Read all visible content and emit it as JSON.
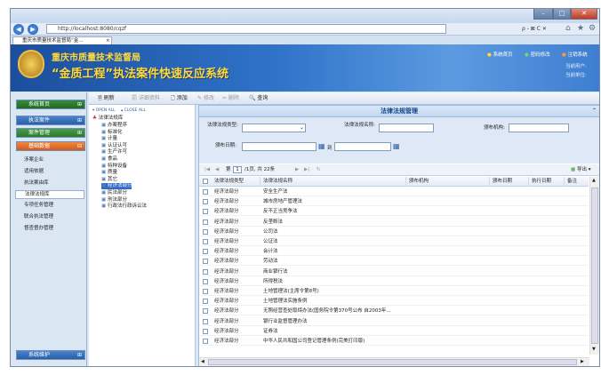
{
  "browser": {
    "url": "http://localhost:8080/cqzf",
    "tab_title": "重庆市质量技术监督局“金...",
    "tab_close": "×",
    "search_controls": "ρ - ⊠ C ✕",
    "window_buttons": {
      "minimize": "–",
      "maximize": "□",
      "close": "✕"
    }
  },
  "header": {
    "org_name": "重庆市质量技术监督局",
    "system_name": "“金质工程”执法案件快速反应系统",
    "links": {
      "home": "系统首页",
      "password": "密码修改",
      "logout": "注销系统"
    },
    "user_line1": "当前用户:",
    "user_line2": "当前单位:"
  },
  "sidebar": {
    "home": "系统首页",
    "cases": "执法案件",
    "case_mgmt": "案件管理",
    "basic_data": "基础数据",
    "items": [
      "涉案企业",
      "适用依据",
      "执法案由库",
      "法律法规库",
      "专项任务管理",
      "联合执法管理",
      "督查督办管理"
    ],
    "maintenance": "系统维护"
  },
  "toolbar": {
    "refresh": "刷新",
    "details": "详细资料",
    "add": "添加",
    "edit": "修改",
    "delete": "删除",
    "query": "查询"
  },
  "tree": {
    "open_all": "OPEN ALL",
    "close_all": "CLOSE ALL",
    "root": "法律法规库",
    "nodes": [
      "办案程序",
      "标准化",
      "计量",
      "认证认可",
      "生产许可",
      "食品",
      "特种设备",
      "质量",
      "其它",
      "经济法部分",
      "民法部分",
      "刑法部分",
      "行政法行政诉讼法"
    ]
  },
  "panel": {
    "title": "法律法规管理",
    "form": {
      "type_label": "法律法规类型:",
      "name_label": "法律法规名称:",
      "agency_label": "颁布机构:",
      "date_label": "颁布日期:",
      "to": "到"
    },
    "pager": {
      "page_prefix": "第",
      "page_value": "1",
      "page_suffix": "/1页, 共 22条",
      "export": "导出"
    },
    "columns": [
      "法律法规类型",
      "法律法规名称",
      "颁布机构",
      "颁布日期",
      "执行日期",
      "备注"
    ],
    "rows": [
      {
        "type": "经济法部分",
        "name": "安全生产法"
      },
      {
        "type": "经济法部分",
        "name": "城市房地产管理法"
      },
      {
        "type": "经济法部分",
        "name": "反不正当竞争法"
      },
      {
        "type": "经济法部分",
        "name": "反垄断法"
      },
      {
        "type": "经济法部分",
        "name": "公司法"
      },
      {
        "type": "经济法部分",
        "name": "公证法"
      },
      {
        "type": "经济法部分",
        "name": "会计法"
      },
      {
        "type": "经济法部分",
        "name": "劳动法"
      },
      {
        "type": "经济法部分",
        "name": "商业银行法"
      },
      {
        "type": "经济法部分",
        "name": "所得税法"
      },
      {
        "type": "经济法部分",
        "name": "土地管理法(主席令第8号)"
      },
      {
        "type": "经济法部分",
        "name": "土地管理法实施条例"
      },
      {
        "type": "经济法部分",
        "name": "无照经营查处取缔办法(国务院令第370号公布 自2003年..."
      },
      {
        "type": "经济法部分",
        "name": "银行业监督管理办法"
      },
      {
        "type": "经济法部分",
        "name": "证券法"
      },
      {
        "type": "经济法部分",
        "name": "中华人民共和国公司登记管理条例(完美打印版)"
      }
    ]
  },
  "colors": {
    "accent": "#2f73c9",
    "menu_active": "#e8692a",
    "header_text": "#ffd93a"
  }
}
